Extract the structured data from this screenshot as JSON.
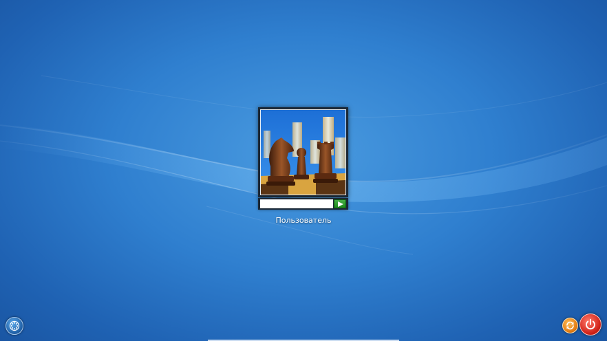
{
  "login": {
    "user_name": "Пользователь",
    "password_value": "",
    "user_picture_icon": "chess-pieces-picture",
    "submit_icon": "arrow-right-icon"
  },
  "controls": {
    "ease_of_access_icon": "ease-of-access-icon",
    "restart_icon": "restart-icon",
    "shutdown_icon": "power-icon"
  },
  "colors": {
    "background": "#2f7fcf",
    "tile_frame": "#1b2836",
    "submit_button": "#2c9a2c",
    "restart_button": "#e27b12",
    "shutdown_button": "#d1241a"
  }
}
